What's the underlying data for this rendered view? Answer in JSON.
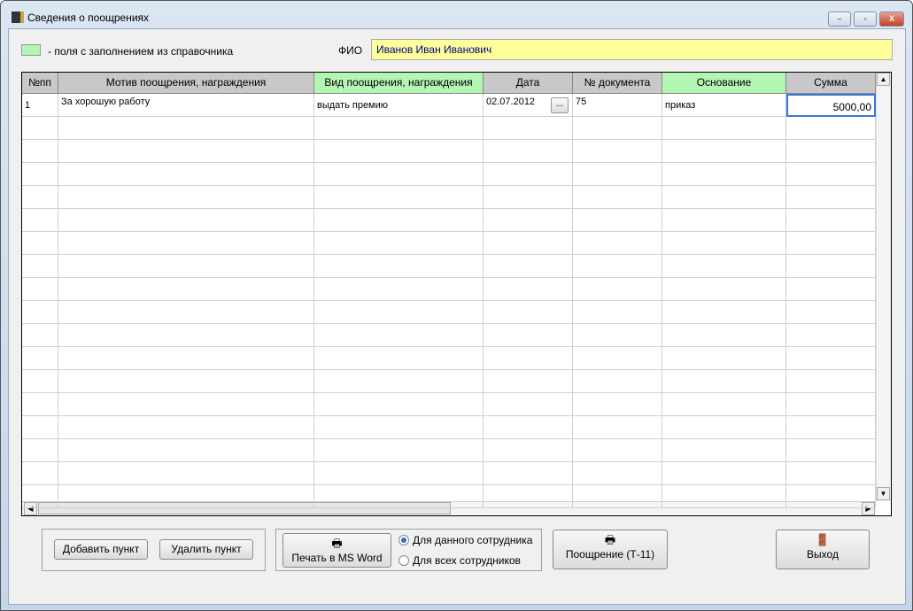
{
  "window": {
    "title": "Сведения о поощрениях",
    "min": "–",
    "max": "▫",
    "close": "X"
  },
  "legend": {
    "text": "- поля с заполнением из справочника",
    "color": "#b3f5b3"
  },
  "fio": {
    "label": "ФИО",
    "value": "Иванов Иван Иванович"
  },
  "table": {
    "columns": [
      {
        "label": "№пп",
        "lookup": false
      },
      {
        "label": "Мотив поощрения, награждения",
        "lookup": false
      },
      {
        "label": "Вид поощрения, награждения",
        "lookup": true
      },
      {
        "label": "Дата",
        "lookup": false
      },
      {
        "label": "№ документа",
        "lookup": false
      },
      {
        "label": "Основание",
        "lookup": true
      },
      {
        "label": "Сумма",
        "lookup": false
      }
    ],
    "rows": [
      [
        "1",
        "За хорошую работу",
        "выдать премию",
        "02.07.2012",
        "75",
        "приказ",
        "5000,00"
      ]
    ],
    "date_button": "..."
  },
  "buttons": {
    "add": "Добавить пункт",
    "delete": "Удалить пункт",
    "print_word": "Печать в MS Word",
    "t11": "Поощрение (Т-11)",
    "exit": "Выход"
  },
  "print_options": [
    {
      "label": "Для данного сотрудника",
      "selected": true
    },
    {
      "label": "Для всех сотрудников",
      "selected": false
    }
  ]
}
